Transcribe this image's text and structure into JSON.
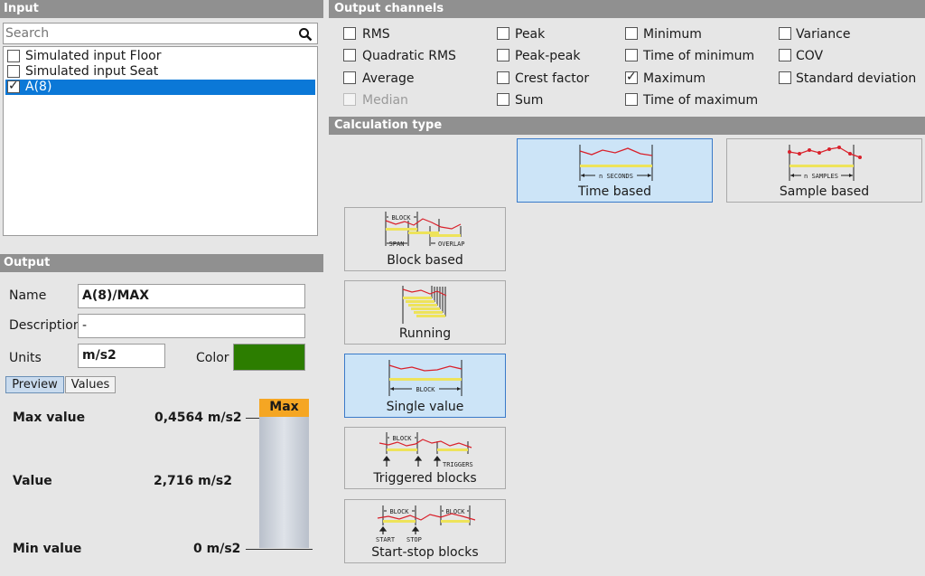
{
  "input": {
    "header": "Input",
    "search_placeholder": "Search",
    "items": [
      {
        "label": "Simulated input Floor",
        "checked": false,
        "selected": false
      },
      {
        "label": "Simulated input Seat",
        "checked": false,
        "selected": false
      },
      {
        "label": "A(8)",
        "checked": true,
        "selected": true
      }
    ]
  },
  "output": {
    "header": "Output",
    "name_label": "Name",
    "name_value": "A(8)/MAX",
    "description_label": "Description",
    "description_value": "-",
    "units_label": "Units",
    "units_value": "m/s2",
    "color_label": "Color",
    "color_value": "#2c7d00",
    "tabs": [
      "Preview",
      "Values"
    ],
    "active_tab": "Preview",
    "preview": {
      "max_label": "Max value",
      "max_value": "0,4564 m/s2",
      "value_label": "Value",
      "value_value": "2,716 m/s2",
      "min_label": "Min value",
      "min_value": "0 m/s2",
      "gauge_label": "Max"
    }
  },
  "channels": {
    "header": "Output channels",
    "items": [
      {
        "label": "RMS",
        "checked": false,
        "disabled": false
      },
      {
        "label": "Quadratic RMS",
        "checked": false,
        "disabled": false
      },
      {
        "label": "Average",
        "checked": false,
        "disabled": false
      },
      {
        "label": "Median",
        "checked": false,
        "disabled": true
      },
      {
        "label": "Peak",
        "checked": false,
        "disabled": false
      },
      {
        "label": "Peak-peak",
        "checked": false,
        "disabled": false
      },
      {
        "label": "Crest factor",
        "checked": false,
        "disabled": false
      },
      {
        "label": "Sum",
        "checked": false,
        "disabled": false
      },
      {
        "label": "Minimum",
        "checked": false,
        "disabled": false
      },
      {
        "label": "Time of minimum",
        "checked": false,
        "disabled": false
      },
      {
        "label": "Maximum",
        "checked": true,
        "disabled": false
      },
      {
        "label": "Time of maximum",
        "checked": false,
        "disabled": false
      },
      {
        "label": "Variance",
        "checked": false,
        "disabled": false
      },
      {
        "label": "COV",
        "checked": false,
        "disabled": false
      },
      {
        "label": "Standard deviation",
        "checked": false,
        "disabled": false
      }
    ]
  },
  "calculation": {
    "header": "Calculation type",
    "time_based": {
      "label": "Time based",
      "diagram_text": "n SECONDS",
      "selected": true
    },
    "sample_based": {
      "label": "Sample based",
      "diagram_text": "n SAMPLES",
      "selected": false
    },
    "block_based": {
      "label": "Block based",
      "diagram_block": "BLOCK",
      "diagram_span": "SPAN",
      "diagram_overlap": "OVERLAP",
      "selected": false
    },
    "running": {
      "label": "Running",
      "selected": false
    },
    "single_value": {
      "label": "Single value",
      "diagram_text": "BLOCK",
      "selected": true
    },
    "triggered": {
      "label": "Triggered blocks",
      "diagram_block": "BLOCK",
      "diagram_triggers": "TRIGGERS",
      "selected": false
    },
    "start_stop": {
      "label": "Start-stop blocks",
      "diagram_block": "BLOCK",
      "diagram_start": "START",
      "diagram_stop": "STOP",
      "selected": false
    }
  }
}
